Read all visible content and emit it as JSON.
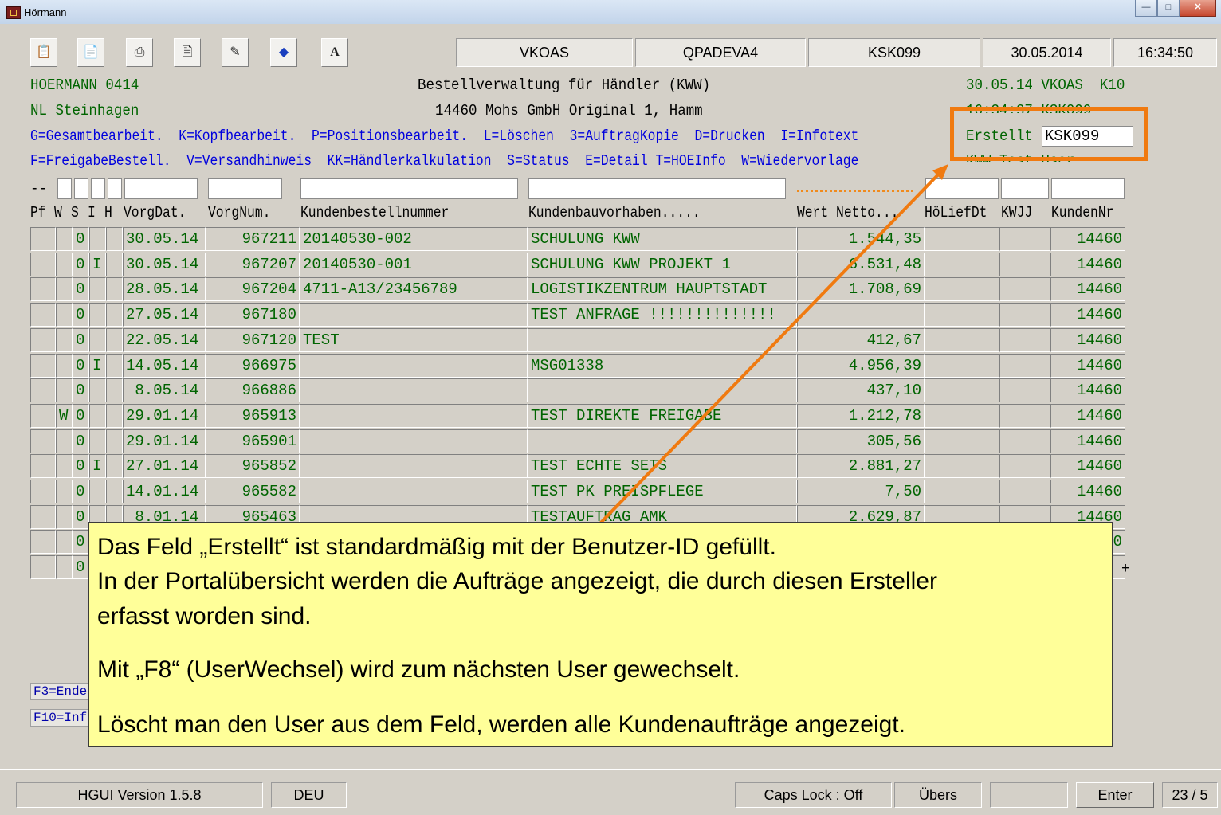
{
  "window": {
    "title": "Hörmann"
  },
  "toolbar": {
    "buttons": [
      "copy-icon",
      "paste-icon",
      "print-icon",
      "document-icon",
      "print-screen-icon",
      "diamond-icon",
      "A"
    ],
    "fields": [
      "VKOAS",
      "QPADEVA4",
      "KSK099",
      "30.05.2014",
      "16:34:50"
    ]
  },
  "header": {
    "company": "HOERMANN 0414",
    "title": "Bestellverwaltung für Händler (KWW)",
    "date_user": "30.05.14 VKOAS  K10",
    "branch": "NL Steinhagen",
    "customer": "14460 Mohs GmbH Original 1, Hamm",
    "time_user": "16:34:37 KSK099",
    "created_label": "Erstellt",
    "created_value": "KSK099",
    "user_name": "KWW Test User"
  },
  "commands": {
    "line1": "G=Gesamtbearbeit.  K=Kopfbearbeit.  P=Positionsbearbeit.  L=Löschen  3=AuftragKopie  D=Drucken  I=Infotext",
    "line2": "F=FreigabeBestell.  V=Versandhinweis  KK=Händlerkalkulation  S=Status  E=Detail T=HOEInfo  W=Wiedervorlage"
  },
  "filter_prefix": "--",
  "columns": [
    "Pf",
    "W",
    "S",
    "I",
    "H",
    "VorgDat.",
    "VorgNum.",
    "Kundenbestellnummer",
    "Kundenbauvorhaben.....",
    "Wert Netto...",
    "HöLiefDt",
    "KWJJ",
    "KundenNr"
  ],
  "rows": [
    {
      "pf": "",
      "w": "",
      "s": "0",
      "i": "",
      "h": "",
      "date": "30.05.14",
      "num": "967211",
      "order": "20140530-002",
      "project": "SCHULUNG KWW",
      "value": "1.544,35",
      "del": "",
      "kw": "",
      "cust": "14460"
    },
    {
      "pf": "",
      "w": "",
      "s": "0",
      "i": "I",
      "h": "",
      "date": "30.05.14",
      "num": "967207",
      "order": "20140530-001",
      "project": "SCHULUNG KWW PROJEKT 1",
      "value": "6.531,48",
      "del": "",
      "kw": "",
      "cust": "14460"
    },
    {
      "pf": "",
      "w": "",
      "s": "0",
      "i": "",
      "h": "",
      "date": "28.05.14",
      "num": "967204",
      "order": "4711-A13/23456789",
      "project": "LOGISTIKZENTRUM HAUPTSTADT",
      "value": "1.708,69",
      "del": "",
      "kw": "",
      "cust": "14460"
    },
    {
      "pf": "",
      "w": "",
      "s": "0",
      "i": "",
      "h": "",
      "date": "27.05.14",
      "num": "967180",
      "order": "",
      "project": "TEST ANFRAGE !!!!!!!!!!!!!!",
      "value": "",
      "del": "",
      "kw": "",
      "cust": "14460"
    },
    {
      "pf": "",
      "w": "",
      "s": "0",
      "i": "",
      "h": "",
      "date": "22.05.14",
      "num": "967120",
      "order": "TEST",
      "project": "",
      "value": "412,67",
      "del": "",
      "kw": "",
      "cust": "14460"
    },
    {
      "pf": "",
      "w": "",
      "s": "0",
      "i": "I",
      "h": "",
      "date": "14.05.14",
      "num": "966975",
      "order": "",
      "project": "MSG01338",
      "value": "4.956,39",
      "del": "",
      "kw": "",
      "cust": "14460"
    },
    {
      "pf": "",
      "w": "",
      "s": "0",
      "i": "",
      "h": "",
      "date": " 8.05.14",
      "num": "966886",
      "order": "",
      "project": "",
      "value": "437,10",
      "del": "",
      "kw": "",
      "cust": "14460"
    },
    {
      "pf": "",
      "w": "W",
      "s": "0",
      "i": "",
      "h": "",
      "date": "29.01.14",
      "num": "965913",
      "order": "",
      "project": "TEST DIREKTE FREIGABE",
      "value": "1.212,78",
      "del": "",
      "kw": "",
      "cust": "14460"
    },
    {
      "pf": "",
      "w": "",
      "s": "0",
      "i": "",
      "h": "",
      "date": "29.01.14",
      "num": "965901",
      "order": "",
      "project": "",
      "value": "305,56",
      "del": "",
      "kw": "",
      "cust": "14460"
    },
    {
      "pf": "",
      "w": "",
      "s": "0",
      "i": "I",
      "h": "",
      "date": "27.01.14",
      "num": "965852",
      "order": "",
      "project": "TEST ECHTE SETS",
      "value": "2.881,27",
      "del": "",
      "kw": "",
      "cust": "14460"
    },
    {
      "pf": "",
      "w": "",
      "s": "0",
      "i": "",
      "h": "",
      "date": "14.01.14",
      "num": "965582",
      "order": "",
      "project": "TEST PK PREISPFLEGE",
      "value": "7,50",
      "del": "",
      "kw": "",
      "cust": "14460"
    },
    {
      "pf": "",
      "w": "",
      "s": "0",
      "i": "",
      "h": "",
      "date": " 8.01.14",
      "num": "965463",
      "order": "",
      "project": "TESTAUFTRAG AMK",
      "value": "2.629,87",
      "del": "",
      "kw": "",
      "cust": "14460"
    },
    {
      "pf": "",
      "w": "",
      "s": "0",
      "i": "",
      "h": "",
      "date": "",
      "num": "",
      "order": "",
      "project": "",
      "value": "",
      "del": "",
      "kw": "",
      "cust": "0"
    },
    {
      "pf": "",
      "w": "",
      "s": "0",
      "i": "",
      "h": "",
      "date": "",
      "num": "",
      "order": "",
      "project": "",
      "value": "",
      "del": "",
      "kw": "",
      "cust": ""
    }
  ],
  "more_indicator": "+",
  "fkeys": [
    "F3=Ende",
    "F10=Inf"
  ],
  "callout": {
    "line1": "Das Feld „Erstellt“ ist standardmäßig mit der Benutzer-ID gefüllt.",
    "line2": "In der Portalübersicht werden die Aufträge angezeigt, die durch diesen Ersteller",
    "line3": "erfasst worden sind.",
    "line4": "Mit „F8“ (UserWechsel) wird zum nächsten User gewechselt.",
    "line5": "Löscht man den User aus dem Feld, werden alle Kundenaufträge angezeigt."
  },
  "statusbar": {
    "version": "HGUI Version 1.5.8",
    "lang": "DEU",
    "caps": "Caps Lock : Off",
    "overwrite": "Übers",
    "blank": "",
    "enter": "Enter",
    "cursor": "23 / 5"
  },
  "colors": {
    "green_text": "#006400",
    "blue_cmd": "#0000dd",
    "callout_bg": "#ffff99",
    "highlight": "#f07a10"
  }
}
